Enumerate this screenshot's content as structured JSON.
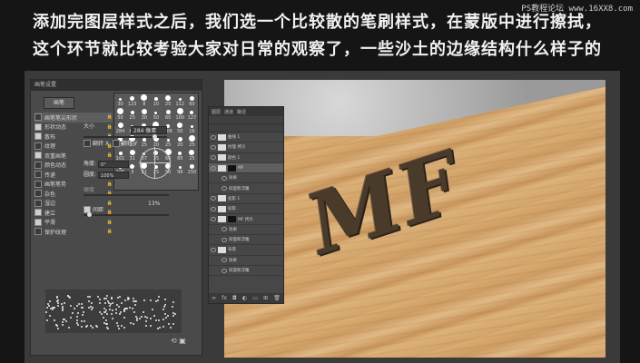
{
  "caption": {
    "line1": "添加完图层样式之后，我们选一个比较散的笔刷样式，在蒙版中进行擦拭，",
    "line2": "这个环节就比较考验大家对日常的观察了，一些沙土的边缘结构什么样子的"
  },
  "watermark": "PS教程论坛 www.16XX8.com",
  "brush_panel": {
    "title": "画笔设置",
    "preset_button": "画笔",
    "options": [
      {
        "label": "画笔笔尖形状",
        "checked": false,
        "selected": true
      },
      {
        "label": "形状动态",
        "checked": true
      },
      {
        "label": "散布",
        "checked": true
      },
      {
        "label": "纹理",
        "checked": false
      },
      {
        "label": "双重画笔",
        "checked": true
      },
      {
        "label": "颜色动态",
        "checked": false
      },
      {
        "label": "传递",
        "checked": false
      },
      {
        "label": "画笔笔势",
        "checked": false
      },
      {
        "label": "杂色",
        "checked": false
      },
      {
        "label": "湿边",
        "checked": false
      },
      {
        "label": "建立",
        "checked": true
      },
      {
        "label": "平滑",
        "checked": true
      },
      {
        "label": "保护纹理",
        "checked": false
      }
    ],
    "tip_sizes": [
      "30",
      "123",
      "8",
      "10",
      "25",
      "112",
      "60",
      "50",
      "25",
      "30",
      "50",
      "60",
      "100",
      "127",
      "284",
      "80",
      "174",
      "175",
      "306",
      "50",
      "16",
      "25",
      "20",
      "25",
      "20",
      "25",
      "20",
      "25",
      "101",
      "31",
      "37",
      "35",
      "60",
      "80",
      "25",
      "105",
      "3",
      "21",
      "25",
      "50",
      "99",
      "150"
    ],
    "size_label": "大小",
    "size_value": "284 像素",
    "flip_x": "翻转 X",
    "flip_y": "翻转 Y",
    "angle_label": "角度:",
    "angle_value": "0°",
    "roundness_label": "圆度:",
    "roundness_value": "100%",
    "hardness_label": "硬度",
    "spacing_label": "间距",
    "spacing_value": "13%"
  },
  "layers_panel": {
    "tabs": [
      "图层",
      "通道",
      "路径"
    ],
    "rows": [
      {
        "label": "曲线 1",
        "type": "adjust"
      },
      {
        "label": "纹理 拷贝",
        "type": "thumb"
      },
      {
        "label": "颜色 1",
        "type": "thumb"
      },
      {
        "label": "MF",
        "type": "mask",
        "selected": true
      },
      {
        "label": "效果",
        "type": "fx"
      },
      {
        "label": "斜面和浮雕",
        "type": "fx"
      },
      {
        "label": "投影 1",
        "type": "thumb"
      },
      {
        "label": "投影",
        "type": "thumb"
      },
      {
        "label": "MF 拷贝",
        "type": "mask"
      },
      {
        "label": "效果",
        "type": "fx"
      },
      {
        "label": "斜面和浮雕",
        "type": "fx"
      },
      {
        "label": "背景",
        "type": "thumb"
      },
      {
        "label": "效果",
        "type": "fx"
      },
      {
        "label": "斜面和浮雕",
        "type": "fx"
      }
    ]
  },
  "canvas": {
    "text": "MF"
  }
}
